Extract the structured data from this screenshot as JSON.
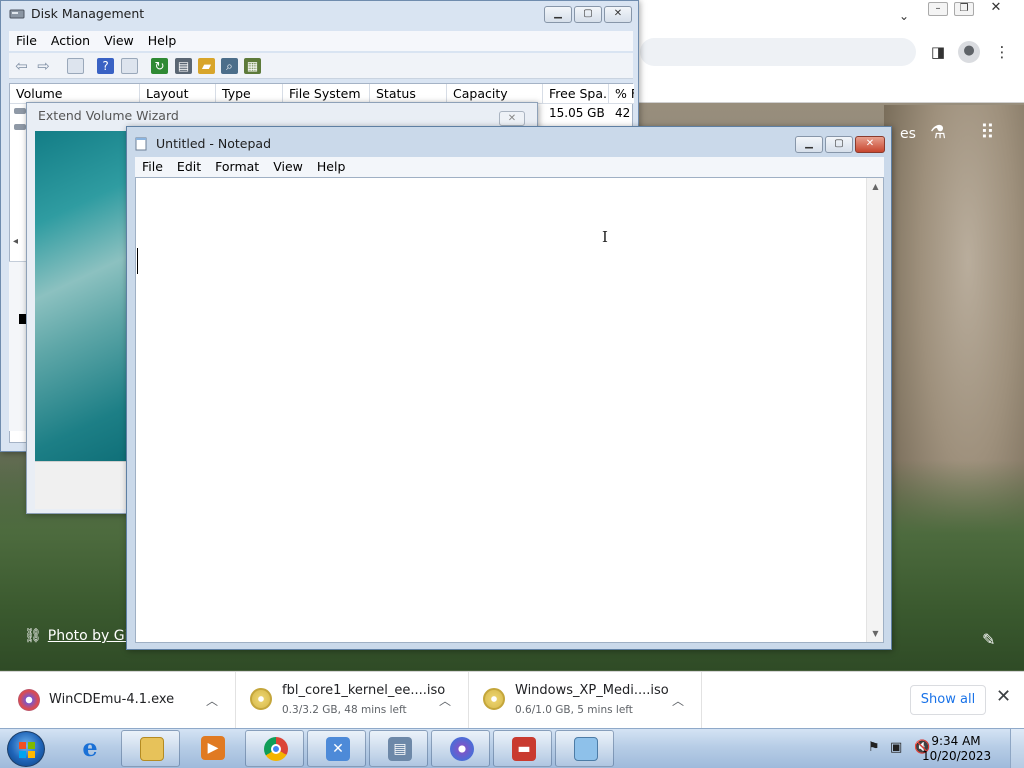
{
  "disk_management": {
    "title": "Disk Management",
    "menu": [
      "File",
      "Action",
      "View",
      "Help"
    ],
    "columns": [
      "Volume",
      "Layout",
      "Type",
      "File System",
      "Status",
      "Capacity",
      "Free Spa...",
      "% F"
    ],
    "row1": {
      "free": "15.05 GB",
      "pct": "42"
    }
  },
  "wizard": {
    "title": "Extend Volume Wizard"
  },
  "notepad": {
    "title": "Untitled - Notepad",
    "menu": [
      "File",
      "Edit",
      "Format",
      "View",
      "Help"
    ],
    "content": ""
  },
  "desktop": {
    "photo_credit": "Photo by Giu"
  },
  "downloads": {
    "items": [
      {
        "name": "WinCDEmu-4.1.exe",
        "status": ""
      },
      {
        "name": "fbl_core1_kernel_ee....iso",
        "status": "0.3/3.2 GB, 48 mins left"
      },
      {
        "name": "Windows_XP_Medi....iso",
        "status": "0.6/1.0 GB, 5 mins left"
      }
    ],
    "show_all": "Show all"
  },
  "taskbar": {
    "time": "9:34 AM",
    "date": "10/20/2023"
  },
  "colors": {
    "win_frame": "#cad9ea",
    "link_blue": "#1a73e8",
    "taskbar": "#b7cde6"
  }
}
